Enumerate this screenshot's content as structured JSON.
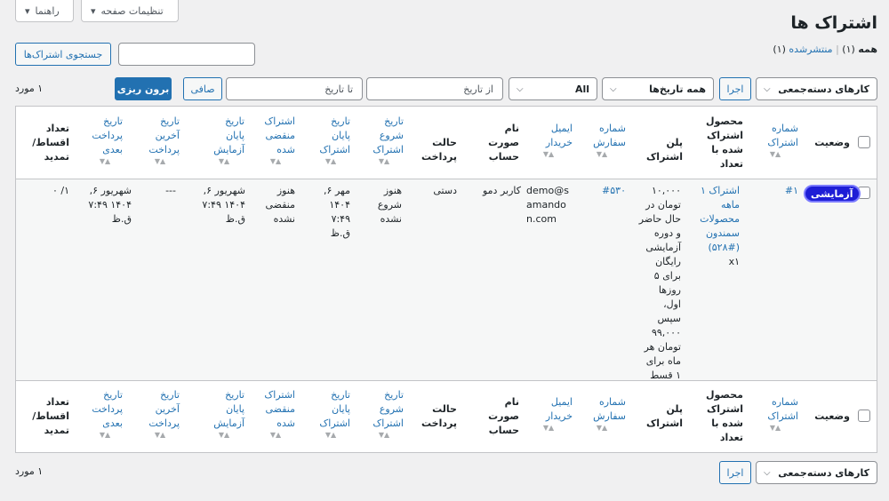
{
  "screen_options": {
    "label": "تنظیمات صفحه"
  },
  "help": {
    "label": "راهنما"
  },
  "page_title": "اشتراک ها",
  "filters": {
    "all_label": "همه",
    "all_count": "(۱)",
    "separator": "|",
    "published_label": "منتشرشده",
    "published_count": "(۱)"
  },
  "search": {
    "button_label": "جستجوی اشتراک‌ها",
    "value": ""
  },
  "bulk_actions": {
    "selected": "کارهای دسته‌جمعی",
    "apply_label": "اجرا"
  },
  "date_filter": {
    "selected": "همه تاریخ‌ها"
  },
  "all_select": {
    "selected": "All"
  },
  "from_date": {
    "placeholder": "از تاریخ"
  },
  "to_date": {
    "placeholder": "تا تاریخ"
  },
  "clear_button": {
    "label": "صافی"
  },
  "export_button": {
    "label": "برون ریزی"
  },
  "items_count": "۱ مورد",
  "columns": {
    "status": "وضعیت",
    "id": "شماره اشتراک",
    "product": "محصول اشتراک شده با تعداد",
    "plan": "پلن اشتراک",
    "order": "شماره سفارش",
    "buyer_email": "ایمیل خریدار",
    "invoice_name": "نام صورت حساب",
    "payment_mode": "حالت پرداخت",
    "start_date": "تاریخ شروع اشتراک",
    "end_date": "تاریخ پایان اشتراک",
    "expired": "اشتراک منقضی شده",
    "trial_end": "تاریخ پایان آزمایش",
    "last_payment": "تاریخ آخرین پرداخت",
    "next_payment": "تاریخ پرداخت بعدی",
    "installments": "تعداد اقساط/ تمدید"
  },
  "rows": [
    {
      "status": "آزمایشی",
      "id": "#۱",
      "product": "اشتراک ۱ ماهه محصولات سمندون (#۵۲۸)",
      "quantity": "x۱",
      "plan": "۱۰,۰۰۰ تومان در حال حاضر و دوره آزمایشی رایگان برای ۵ روزها اول، سپس ۹۹,۰۰۰ تومان هر ماه برای ۱ قسط",
      "order": "#۵۳۰",
      "buyer_email": "demo@samandon.com",
      "invoice_name": "کاربر دمو",
      "payment_mode": "دستی",
      "start_date": "هنوز شروع نشده",
      "end_date": "مهر ۶, ۱۴۰۴ ۷:۴۹ ق.ظ",
      "expired": "هنوز منقضی نشده",
      "trial_end": "شهریور ۶, ۱۴۰۴ ۷:۴۹ ق.ظ",
      "last_payment": "---",
      "next_payment": "شهریور ۶, ۱۴۰۴ ۷:۴۹ ق.ظ",
      "installments": "۱/ ۰"
    }
  ],
  "colors": {
    "accent": "#2271b1",
    "badge": "#1e1ed6",
    "background": "#f0f0f1"
  }
}
